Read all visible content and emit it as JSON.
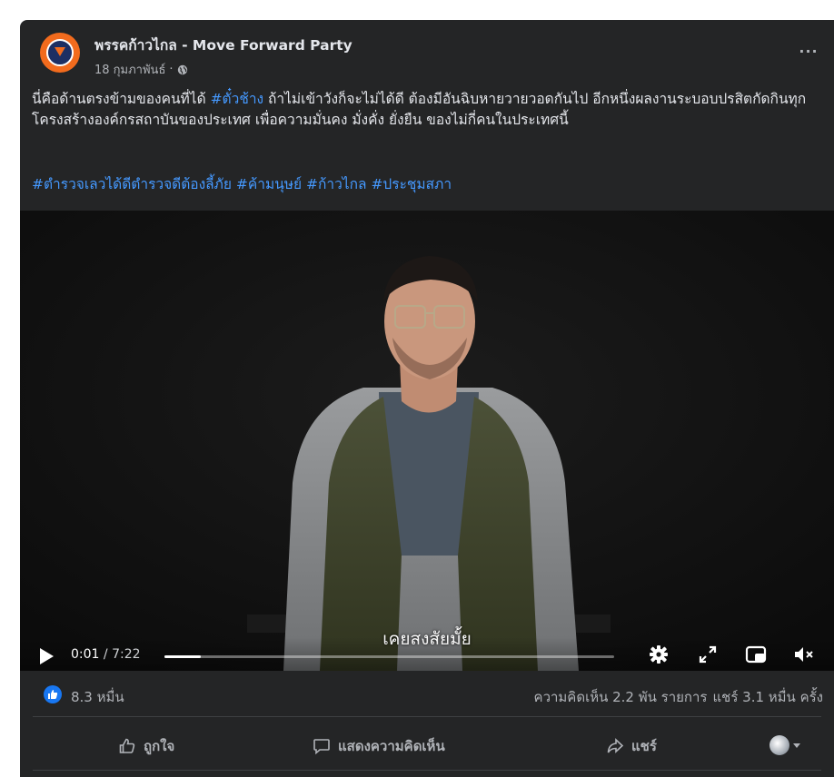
{
  "post": {
    "author": "พรรคก้าวไกล - Move Forward Party",
    "date": "18 กุมภาพันธ์",
    "date_separator": "·",
    "more_label": "···",
    "avatar_brand_color": "#f26b1d",
    "text_before": "นี่คือด้านตรงข้ามของคนที่ได้ ",
    "text_hashtag": "#ตั๋วช้าง",
    "text_after": " ถ้าไม่เข้าวังก็จะไม่ได้ดี ต้องมีอันฉิบหายวายวอดกันไป อีกหนึ่งผลงานระบอบปรสิตกัดกินทุกโครงสร้างองค์กรสถาบันของประเทศ เพื่อความมั่นคง มั่งคั่ง ยั่งยืน ของไม่กี่คนในประเทศนี้",
    "hashtags": [
      "#ตำรวจเลวได้ดีตำรวจดีต้องลี้ภัย",
      "#ค้ามนุษย์",
      "#ก้าวไกล",
      "#ประชุมสภา"
    ],
    "link_color": "#4599ff"
  },
  "video": {
    "subtitle": "เคยสงสัยมั้ย",
    "current_time": "0:01",
    "total_time": "/ 7:22",
    "progress": 0.08
  },
  "stats": {
    "likes": "8.3 หมื่น",
    "comments": "ความคิดเห็น 2.2 พัน รายการ",
    "shares": "แชร์ 3.1 หมื่น ครั้ง"
  },
  "actions": {
    "like": "ถูกใจ",
    "comment": "แสดงความคิดเห็น",
    "share": "แชร์"
  },
  "icons": {
    "privacy": "globe-icon",
    "play": "play-icon",
    "settings": "gear-icon",
    "fullscreen": "expand-icon",
    "pip": "picture-in-picture-icon",
    "mute": "volume-muted-icon",
    "like_reaction": "thumbs-up-icon",
    "comment": "speech-bubble-icon",
    "share": "share-arrow-icon"
  }
}
